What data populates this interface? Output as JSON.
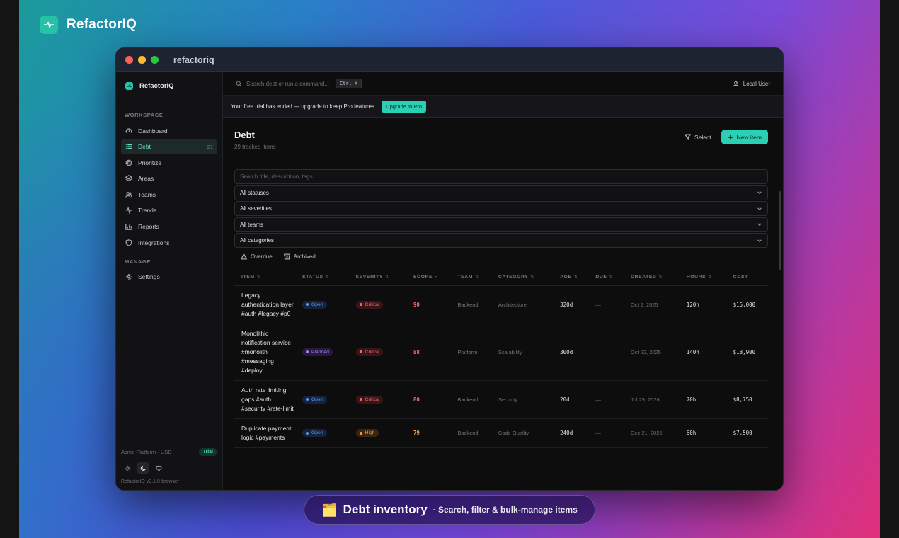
{
  "brand": {
    "name": "RefactorIQ"
  },
  "window": {
    "title": "refactoriq"
  },
  "sidebar": {
    "brand": "RefactorIQ",
    "sections": {
      "workspace": "WORKSPACE",
      "manage": "MANAGE"
    },
    "items": [
      {
        "label": "Dashboard",
        "icon": "gauge-icon"
      },
      {
        "label": "Debt",
        "icon": "list-icon",
        "count": "21",
        "active": true
      },
      {
        "label": "Prioritize",
        "icon": "target-icon"
      },
      {
        "label": "Areas",
        "icon": "layers-icon"
      },
      {
        "label": "Teams",
        "icon": "users-icon"
      },
      {
        "label": "Trends",
        "icon": "activity-icon"
      },
      {
        "label": "Reports",
        "icon": "bar-chart-icon"
      },
      {
        "label": "Integrations",
        "icon": "shield-icon"
      }
    ],
    "manage_items": [
      {
        "label": "Settings",
        "icon": "gear-icon"
      }
    ],
    "org": "Acme Platform · USD",
    "plan_badge": "Trial",
    "version": "RefactorIQ v0.1.0-browser"
  },
  "topbar": {
    "search_placeholder": "Search debt or run a command...",
    "shortcut": "Ctrl K",
    "user": "Local User"
  },
  "banner": {
    "text": "Your free trial has ended — upgrade to keep Pro features.",
    "button": "Upgrade to Pro"
  },
  "page": {
    "title": "Debt",
    "subtitle": "29 tracked items",
    "select_label": "Select",
    "new_label": "New item"
  },
  "filters": {
    "search_placeholder": "Search title, description, tags...",
    "status": "All statuses",
    "severity": "All severities",
    "team": "All teams",
    "category": "All categories",
    "overdue": "Overdue",
    "archived": "Archived"
  },
  "table": {
    "columns": [
      "ITEM",
      "STATUS",
      "SEVERITY",
      "SCORE",
      "TEAM",
      "CATEGORY",
      "AGE",
      "DUE",
      "CREATED",
      "HOURS",
      "COST"
    ],
    "rows": [
      {
        "item": "Legacy authentication layer #auth #legacy #p0",
        "status": "Open",
        "severity": "Critical",
        "score": "90",
        "team": "Backend",
        "category": "Architecture",
        "age": "320d",
        "due": "—",
        "created": "Oct 2, 2025",
        "hours": "120h",
        "cost": "$15,000"
      },
      {
        "item": "Monolithic notification service #monolith #messaging #deploy",
        "status": "Planned",
        "severity": "Critical",
        "score": "88",
        "team": "Platform",
        "category": "Scalability",
        "age": "300d",
        "due": "—",
        "created": "Oct 22, 2025",
        "hours": "140h",
        "cost": "$18,900"
      },
      {
        "item": "Auth rate limiting gaps #auth #security #rate-limit",
        "status": "Open",
        "severity": "Critical",
        "score": "80",
        "team": "Backend",
        "category": "Security",
        "age": "20d",
        "due": "—",
        "created": "Jul 29, 2026",
        "hours": "70h",
        "cost": "$8,750"
      },
      {
        "item": "Duplicate payment logic #payments",
        "status": "Open",
        "severity": "High",
        "score": "79",
        "team": "Backend",
        "category": "Code Quality",
        "age": "240d",
        "due": "—",
        "created": "Dec 21, 2025",
        "hours": "60h",
        "cost": "$7,500"
      }
    ]
  },
  "caption": {
    "icon": "🗂️",
    "title": "Debt inventory",
    "subtitle": "· Search, filter & bulk-manage items"
  },
  "colors": {
    "accent": "#2bd0b4",
    "critical": "#f06a6a",
    "high": "#f09a4a",
    "open": "#5da0f0",
    "planned": "#a884f0"
  }
}
